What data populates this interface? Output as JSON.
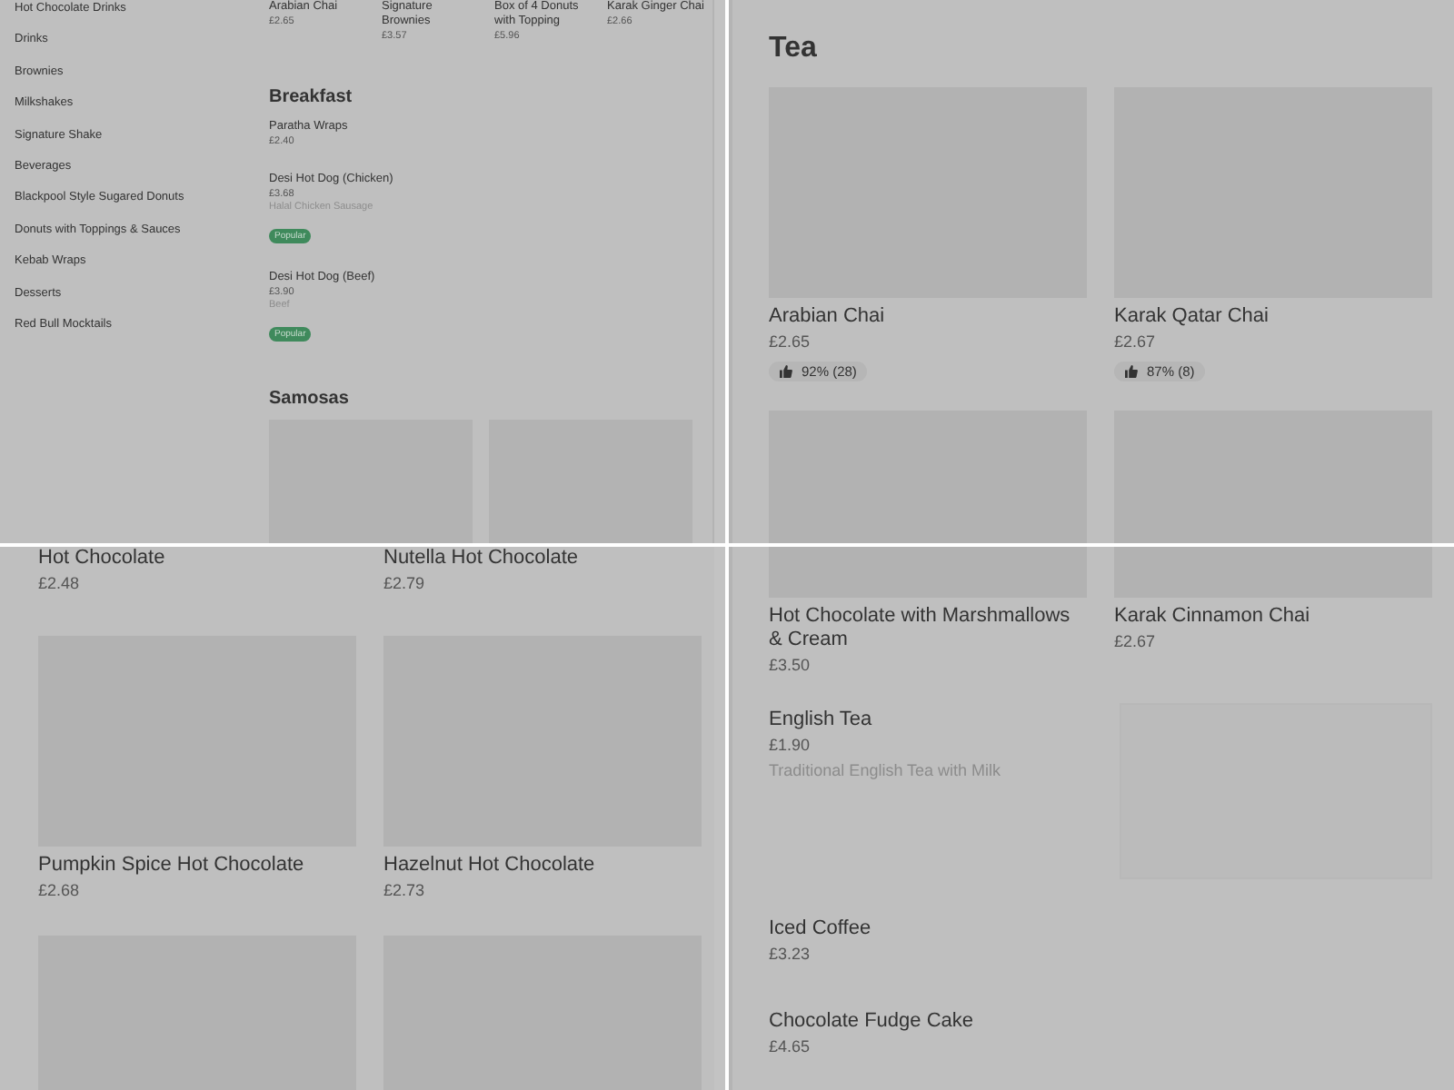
{
  "panels": [
    {
      "kind": "sidebar_menu",
      "sidebar": {
        "items": [
          "Hot Chocolate Drinks",
          "Drinks",
          "Brownies",
          "Milkshakes",
          "Signature Shake",
          "Beverages",
          "Blackpool Style Sugared Donuts",
          "Donuts with Toppings & Sauces",
          "Kebab Wraps",
          "Desserts",
          "Red Bull Mocktails"
        ]
      },
      "top_row": [
        {
          "name": "Arabian Chai",
          "price": "£2.65"
        },
        {
          "name": "Signature Brownies",
          "price": "£3.57"
        },
        {
          "name": "Box of 4 Donuts with Topping",
          "price": "£5.96"
        },
        {
          "name": "Karak Ginger Chai",
          "price": "£2.66"
        }
      ],
      "sections": [
        {
          "title": "Breakfast",
          "kind": "list",
          "items": [
            {
              "name": "Paratha Wraps",
              "price": "£2.40"
            },
            {
              "name": "Desi Hot Dog (Chicken)",
              "price": "£3.68",
              "description": "Halal Chicken Sausage",
              "badge": "Popular"
            },
            {
              "name": "Desi Hot Dog (Beef)",
              "price": "£3.90",
              "description": "Beef",
              "badge": "Popular"
            }
          ]
        },
        {
          "title": "Samosas",
          "kind": "grid",
          "items": [
            {
              "kind": "with_image"
            },
            {
              "kind": "with_image"
            }
          ]
        }
      ]
    },
    {
      "kind": "card_grid",
      "title": "Tea",
      "cards": [
        {
          "kind": "with_image",
          "name": "Arabian Chai",
          "price": "£2.65",
          "rating": "92% (28)"
        },
        {
          "kind": "with_image",
          "name": "Karak Qatar Chai",
          "price": "£2.67",
          "rating": "87% (8)"
        },
        {
          "kind": "with_image"
        },
        {
          "kind": "with_image"
        }
      ]
    },
    {
      "kind": "card_grid",
      "cards": [
        {
          "kind": "text_only",
          "name": "Hot Chocolate",
          "price": "£2.48"
        },
        {
          "kind": "text_only",
          "name": "Nutella Hot Chocolate",
          "price": "£2.79"
        },
        {
          "kind": "with_image",
          "name": "Pumpkin Spice Hot Chocolate",
          "price": "£2.68"
        },
        {
          "kind": "with_image",
          "name": "Hazelnut Hot Chocolate",
          "price": "£2.73"
        },
        {
          "kind": "with_image"
        },
        {
          "kind": "with_image"
        }
      ]
    },
    {
      "kind": "list_after_grid",
      "cards": [
        {
          "kind": "with_image",
          "name": "Hot Chocolate with Marshmallows & Cream",
          "price": "£3.50"
        },
        {
          "kind": "with_image",
          "name": "Karak Cinnamon Chai",
          "price": "£2.67"
        }
      ],
      "items": [
        {
          "kind": "with_image",
          "name": "English Tea",
          "price": "£1.90",
          "description": "Traditional English Tea with Milk"
        },
        {
          "kind": "text_only",
          "name": "Iced Coffee",
          "price": "£3.23"
        },
        {
          "kind": "text_only",
          "name": "Chocolate Fudge Cake",
          "price": "£4.65"
        }
      ]
    }
  ]
}
